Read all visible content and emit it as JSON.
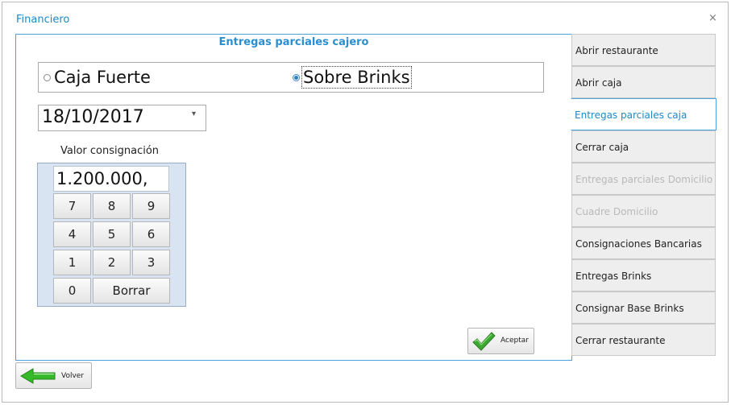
{
  "window": {
    "title": "Financiero",
    "close_glyph": "×"
  },
  "panel": {
    "title": "Entregas parciales cajero",
    "radios": [
      {
        "label": "Caja Fuerte",
        "checked": false
      },
      {
        "label": "Sobre Brinks",
        "checked": true
      }
    ],
    "date_value": "18/10/2017",
    "date_dropdown_icon": "chevron-down-icon",
    "valor_label": "Valor consignación",
    "display_value": "1.200.000,",
    "keys": [
      "7",
      "8",
      "9",
      "4",
      "5",
      "6",
      "1",
      "2",
      "3",
      "0",
      "Borrar"
    ],
    "accept_label": "Aceptar",
    "accept_icon": "checkmark-icon"
  },
  "back": {
    "label": "Volver",
    "icon": "arrow-left-icon"
  },
  "menu": {
    "items": [
      {
        "label": "Abrir restaurante",
        "state": "normal"
      },
      {
        "label": "Abrir caja",
        "state": "normal"
      },
      {
        "label": "Entregas parciales caja",
        "state": "active"
      },
      {
        "label": "Cerrar caja",
        "state": "normal"
      },
      {
        "label": "Entregas parciales Domicilio",
        "state": "disabled"
      },
      {
        "label": "Cuadre Domicilio",
        "state": "disabled"
      },
      {
        "label": "Consignaciones Bancarias",
        "state": "normal"
      },
      {
        "label": "Entregas Brinks",
        "state": "normal"
      },
      {
        "label": "Consignar Base Brinks",
        "state": "normal"
      },
      {
        "label": "Cerrar restaurante",
        "state": "normal"
      }
    ]
  },
  "colors": {
    "accent": "#1e88c8",
    "panel_border": "#4aa3df",
    "keypad_bg": "#d9e4f2",
    "check_green": "#3aa832",
    "arrow_green": "#36b82a"
  }
}
